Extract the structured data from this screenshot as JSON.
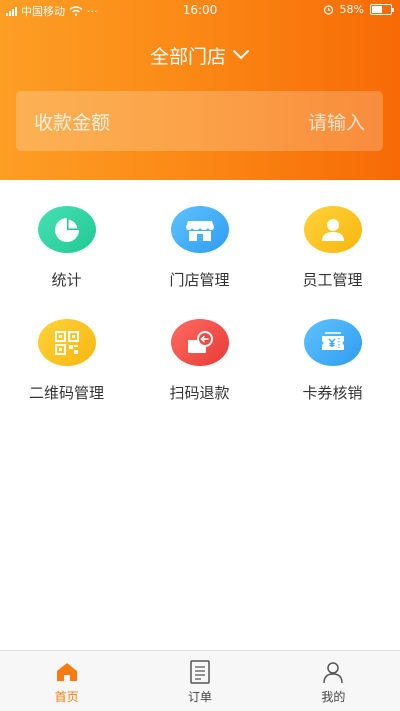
{
  "status_bar": {
    "carrier": "中国移动",
    "more": "···",
    "time": "16:00",
    "battery": "58%",
    "battery_level": 0.58
  },
  "header": {
    "store_selector": "全部门店",
    "amount_label": "收款金额",
    "amount_placeholder": "请输入"
  },
  "menu": [
    {
      "label": "统计",
      "icon": "pie-chart-icon",
      "color": "#2ed4a2"
    },
    {
      "label": "门店管理",
      "icon": "storefront-icon",
      "color": "#3aaaf5"
    },
    {
      "label": "员工管理",
      "icon": "user-icon",
      "color": "#fbc21d"
    },
    {
      "label": "二维码管理",
      "icon": "qr-code-icon",
      "color": "#fbc21d"
    },
    {
      "label": "扫码退款",
      "icon": "refund-icon",
      "color": "#f24a45"
    },
    {
      "label": "卡券核销",
      "icon": "coupon-icon",
      "color": "#3aaaf5"
    }
  ],
  "tabbar": {
    "tabs": [
      {
        "label": "首页",
        "icon": "home-icon",
        "active": true
      },
      {
        "label": "订单",
        "icon": "order-icon",
        "active": false
      },
      {
        "label": "我的",
        "icon": "profile-icon",
        "active": false
      }
    ],
    "active_color": "#f47c10"
  }
}
